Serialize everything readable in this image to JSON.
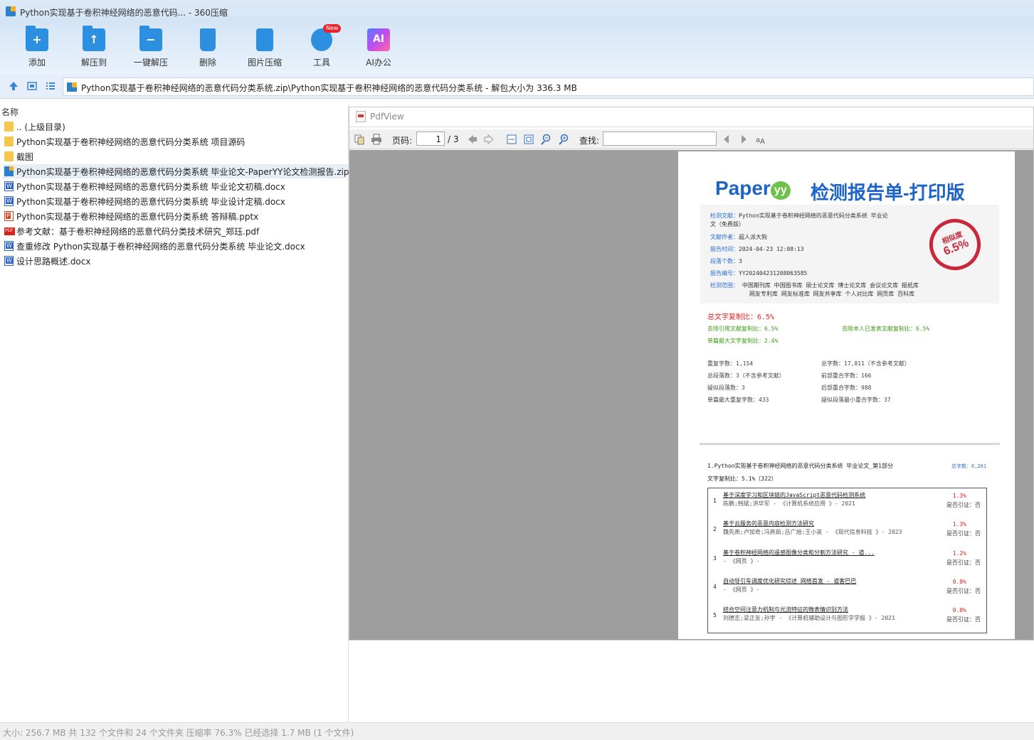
{
  "window": {
    "title": "Python实现基于卷积神经网络的恶意代码... - 360压缩"
  },
  "toolbar": {
    "buttons": [
      {
        "label": "添加",
        "icon": "add-folder-icon"
      },
      {
        "label": "解压到",
        "icon": "extract-to-icon"
      },
      {
        "label": "一键解压",
        "icon": "one-click-extract-icon"
      },
      {
        "label": "删除",
        "icon": "trash-icon"
      },
      {
        "label": "图片压缩",
        "icon": "image-compress-icon"
      },
      {
        "label": "工具",
        "icon": "tools-icon",
        "badge": "New"
      },
      {
        "label": "AI办公",
        "icon": "ai-icon",
        "icon_text": "AI"
      }
    ]
  },
  "address": {
    "path": "Python实现基于卷积神经网络的恶意代码分类系统.zip\\Python实现基于卷积神经网络的恶意代码分类系统 - 解包大小为 336.3 MB"
  },
  "list": {
    "header": "名称",
    "items": [
      {
        "name": ".. (上级目录)",
        "type": "folder"
      },
      {
        "name": "Python实现基于卷积神经网络的恶意代码分类系统 项目源码",
        "type": "folder"
      },
      {
        "name": "截图",
        "type": "folder"
      },
      {
        "name": "Python实现基于卷积神经网络的恶意代码分类系统 毕业论文-PaperYY论文检测报告.zip",
        "type": "zip",
        "selected": true
      },
      {
        "name": "Python实现基于卷积神经网络的恶意代码分类系统 毕业论文初稿.docx",
        "type": "docx"
      },
      {
        "name": "Python实现基于卷积神经网络的恶意代码分类系统 毕业设计定稿.docx",
        "type": "docx"
      },
      {
        "name": "Python实现基于卷积神经网络的恶意代码分类系统 答辩稿.pptx",
        "type": "pptx"
      },
      {
        "name": "参考文献：基于卷积神经网络的恶意代码分类技术研究_郑珏.pdf",
        "type": "pdf"
      },
      {
        "name": "查重修改 Python实现基于卷积神经网络的恶意代码分类系统 毕业论文.docx",
        "type": "docx"
      },
      {
        "name": "设计思路概述.docx",
        "type": "docx"
      }
    ]
  },
  "pdfview": {
    "title": "PdfView",
    "page_label": "页码:",
    "page_current": "1",
    "page_total": "/ 3",
    "find_label": "查找:",
    "find_value": ""
  },
  "report": {
    "logo": "Paper",
    "logo_yy": "yy",
    "title": "检测报告单-打印版",
    "info": {
      "doc_k": "检测文献：",
      "doc_v": "Python实现基于卷积神经网络的恶意代码分类系统 毕业论",
      "doc_v2": "文（免费版）",
      "author_k": "文献作者：",
      "author_v": "超人派大狗",
      "time_k": "报告时间：",
      "time_v": "2024-04-23 12:08:13",
      "paras_k": "段落个数：",
      "paras_v": "3",
      "num_k": "报告编号：",
      "num_v": "YY202404231208063585",
      "scope_k": "检测范围：",
      "scope_v": "中国期刊库 中国图书库 硕士论文库 博士论文库 会议论文库 报纸库",
      "scope_v2": "网友专利库 网友标准库 网友共享库 个人对比库 网页库 百科库"
    },
    "stamp": {
      "top": "相似度",
      "value": "6.5%"
    },
    "total_ratio": "总文字复制比：6.5%",
    "excl_ref": "去除引用文献复制比：6.5%",
    "excl_self": "去除本人已发表文献复制比：6.5%",
    "max_single": "单篇最大文字复制比：2.4%",
    "stats": {
      "dup_chars": "重复字数：1,154",
      "total_chars": "总字数：17,811（不含参考文献）",
      "total_paras": "总段落数：3（不含参考文献）",
      "front_overlap": "前部重合字数：166",
      "sim_paras": "疑似段落数：3",
      "back_overlap": "后部重合字数：988",
      "max_dup": "单篇最大重复字数：433",
      "min_overlap": "疑似段落最小重合字数：37"
    },
    "section": {
      "heading": "1.Python实现基于卷积神经网络的恶意代码分类系统 毕业论文_第1部分",
      "words": "总字数：6,261",
      "ratio": "文字复制比：5.1%（322）"
    },
    "sources": [
      {
        "n": "1",
        "title": "基于深度学习和区块链的JavaScript恶意代码检测系统",
        "authors": "陈鹏;韩斌;洪华军 - 《计算机系统应用 》- 2021",
        "pct": "1.3%",
        "cite": "是否引证：否"
      },
      {
        "n": "2",
        "title": "基于云服务的恶意内容检测方法研究",
        "authors": "魏先燕;卢加奇;冯燕茹;吕广旭;王小英 - 《现代信息科技 》- 2023",
        "pct": "1.3%",
        "cite": "是否引证：否"
      },
      {
        "n": "3",
        "title": "基于卷积神经网络的遥感图像分类和分割方法研究 - 道...",
        "authors": "- 《网页 》-",
        "pct": "1.2%",
        "cite": "是否引证：否"
      },
      {
        "n": "4",
        "title": "自动导引车调度优化研究综述 网络首发 - 道客巴巴",
        "authors": "- 《网页 》-",
        "pct": "0.8%",
        "cite": "是否引证：否"
      },
      {
        "n": "5",
        "title": "结合空间注意力机制与光流特征的微表情识别方法",
        "authors": "刘德志;梁正友;孙宇 - 《计算机辅助设计与图形学学报 》- 2021",
        "pct": "0.8%",
        "cite": "是否引证：否"
      }
    ]
  },
  "status": "大小: 256.7 MB 共 132 个文件和 24 个文件夹 压缩率 76.3% 已经选择 1.7 MB (1 个文件)"
}
